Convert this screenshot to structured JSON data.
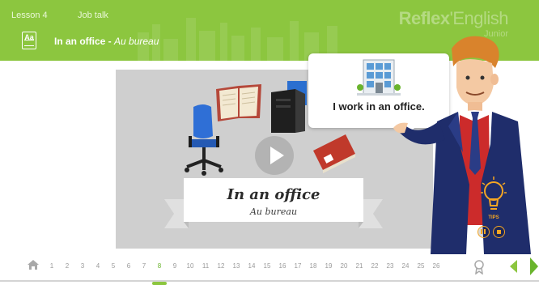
{
  "header": {
    "lesson": "Lesson 4",
    "topic": "Job talk",
    "title_en": "In an office",
    "title_sep": " - ",
    "title_fr": "Au bureau",
    "brand_main": "Reflex",
    "brand_rest": "'English",
    "brand_sub": "Junior"
  },
  "stage": {
    "banner_title": "In an office",
    "banner_subtitle": "Au bureau"
  },
  "bubble": {
    "text": "I work in an office."
  },
  "tips": {
    "label": "TIPS"
  },
  "nav": {
    "pages": [
      "1",
      "2",
      "3",
      "4",
      "5",
      "6",
      "7",
      "8",
      "9",
      "10",
      "11",
      "12",
      "13",
      "14",
      "15",
      "16",
      "17",
      "18",
      "19",
      "20",
      "21",
      "22",
      "23",
      "24",
      "25",
      "26"
    ],
    "active_page": "8"
  },
  "colors": {
    "brand_green": "#8cc63f",
    "active_green": "#6ab42d",
    "tips_orange": "#f5a623",
    "stage_gray": "#cfcfcf"
  },
  "icons": {
    "home": "home-icon",
    "lesson_book": "book-icon",
    "award": "award-icon",
    "prev": "arrow-left-icon",
    "next": "arrow-right-icon",
    "play": "play-icon",
    "tips": "lightbulb-icon",
    "pause": "pause-icon",
    "stop": "stop-icon"
  }
}
